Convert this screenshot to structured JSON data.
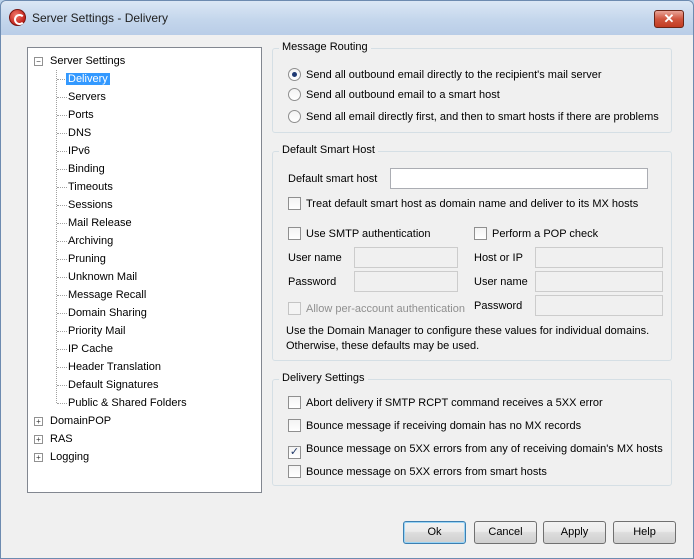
{
  "window": {
    "title": "Server Settings - Delivery",
    "close_glyph": "✕"
  },
  "tree": {
    "root": {
      "label": "Server Settings",
      "expander": "−"
    },
    "children": [
      "Delivery",
      "Servers",
      "Ports",
      "DNS",
      "IPv6",
      "Binding",
      "Timeouts",
      "Sessions",
      "Mail Release",
      "Archiving",
      "Pruning",
      "Unknown Mail",
      "Message Recall",
      "Domain Sharing",
      "Priority Mail",
      "IP Cache",
      "Header Translation",
      "Default Signatures",
      "Public & Shared Folders"
    ],
    "selected": "Delivery",
    "others": [
      {
        "label": "DomainPOP",
        "expander": "+"
      },
      {
        "label": "RAS",
        "expander": "+"
      },
      {
        "label": "Logging",
        "expander": "+"
      }
    ]
  },
  "message_routing": {
    "title": "Message Routing",
    "options": [
      {
        "label": "Send all outbound email directly to the recipient's mail server",
        "selected": true
      },
      {
        "label": "Send all outbound email to a smart host",
        "selected": false
      },
      {
        "label": "Send all email directly first, and then to smart hosts if there are problems",
        "selected": false
      }
    ]
  },
  "smart_host": {
    "title": "Default Smart Host",
    "host_label": "Default smart host",
    "host_value": "",
    "treat_as_domain": {
      "label": "Treat default smart host as domain name and deliver to its MX hosts",
      "checked": false
    },
    "smtp_auth": {
      "label": "Use SMTP authentication",
      "checked": false
    },
    "pop_check": {
      "label": "Perform a POP check",
      "checked": false
    },
    "user_name_label": "User name",
    "password_label": "Password",
    "host_or_ip_label": "Host or IP",
    "pop_user_label": "User name",
    "pop_password_label": "Password",
    "per_account": {
      "label": "Allow per-account authentication",
      "checked": false
    },
    "note": "Use the Domain Manager to configure these values for individual domains. Otherwise, these defaults may be used."
  },
  "delivery_settings": {
    "title": "Delivery Settings",
    "options": [
      {
        "label": "Abort delivery if SMTP RCPT command receives a 5XX error",
        "checked": false
      },
      {
        "label": "Bounce message if receiving domain has no MX records",
        "checked": false
      },
      {
        "label": "Bounce message on 5XX errors from any of receiving domain's MX hosts",
        "checked": true
      },
      {
        "label": "Bounce message on 5XX errors from smart hosts",
        "checked": false
      }
    ]
  },
  "buttons": {
    "ok": "Ok",
    "cancel": "Cancel",
    "apply": "Apply",
    "help": "Help"
  },
  "check_glyph": "✓"
}
